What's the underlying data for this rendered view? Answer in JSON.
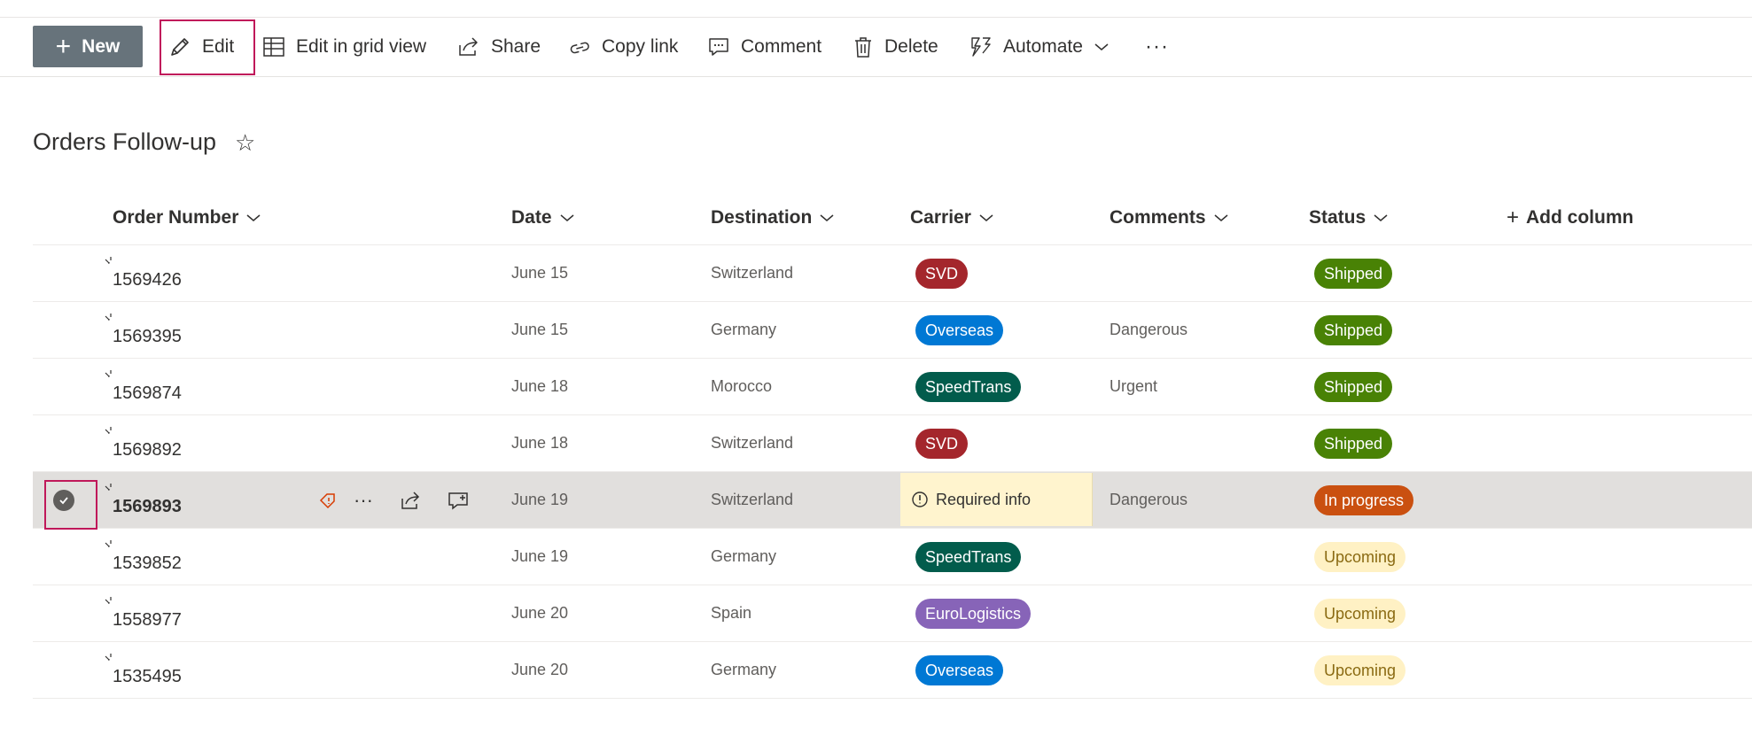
{
  "toolbar": {
    "new_label": "New",
    "edit_label": "Edit",
    "grid_label": "Edit in grid view",
    "share_label": "Share",
    "copy_link_label": "Copy link",
    "comment_label": "Comment",
    "delete_label": "Delete",
    "automate_label": "Automate",
    "more_label": "···"
  },
  "page": {
    "title": "Orders Follow-up",
    "favorite_icon": "☆"
  },
  "columns": {
    "order_number": "Order Number",
    "date": "Date",
    "destination": "Destination",
    "carrier": "Carrier",
    "comments": "Comments",
    "status": "Status",
    "add_column": "Add column"
  },
  "rows": [
    {
      "order": "1569426",
      "date": "June 15",
      "destination": "Switzerland",
      "carrier": "SVD",
      "comments": "",
      "status": "Shipped"
    },
    {
      "order": "1569395",
      "date": "June 15",
      "destination": "Germany",
      "carrier": "Overseas",
      "comments": "Dangerous",
      "status": "Shipped"
    },
    {
      "order": "1569874",
      "date": "June 18",
      "destination": "Morocco",
      "carrier": "SpeedTrans",
      "comments": "Urgent",
      "status": "Shipped"
    },
    {
      "order": "1569892",
      "date": "June 18",
      "destination": "Switzerland",
      "carrier": "SVD",
      "comments": "",
      "status": "Shipped"
    },
    {
      "order": "1569893",
      "date": "June 19",
      "destination": "Switzerland",
      "carrier": "Required info",
      "comments": "Dangerous",
      "status": "In progress",
      "selected": true
    },
    {
      "order": "1539852",
      "date": "June 19",
      "destination": "Germany",
      "carrier": "SpeedTrans",
      "comments": "",
      "status": "Upcoming"
    },
    {
      "order": "1558977",
      "date": "June 20",
      "destination": "Spain",
      "carrier": "EuroLogistics",
      "comments": "",
      "status": "Upcoming"
    },
    {
      "order": "1535495",
      "date": "June 20",
      "destination": "Germany",
      "carrier": "Overseas",
      "comments": "",
      "status": "Upcoming"
    }
  ],
  "colors": {
    "new_button": "#67737b",
    "highlight_box": "#c0185a",
    "carrier_svd": "#a4262c",
    "carrier_overseas": "#0078d4",
    "carrier_speedtrans": "#025c4c",
    "carrier_eurologistics": "#8764b8",
    "status_shipped": "#498205",
    "status_in_progress": "#ca5010",
    "status_upcoming_bg": "#fff1c4",
    "status_upcoming_text": "#8a6a12",
    "required_info_bg": "#fff4ce",
    "selected_row_bg": "#e1dfdd"
  }
}
